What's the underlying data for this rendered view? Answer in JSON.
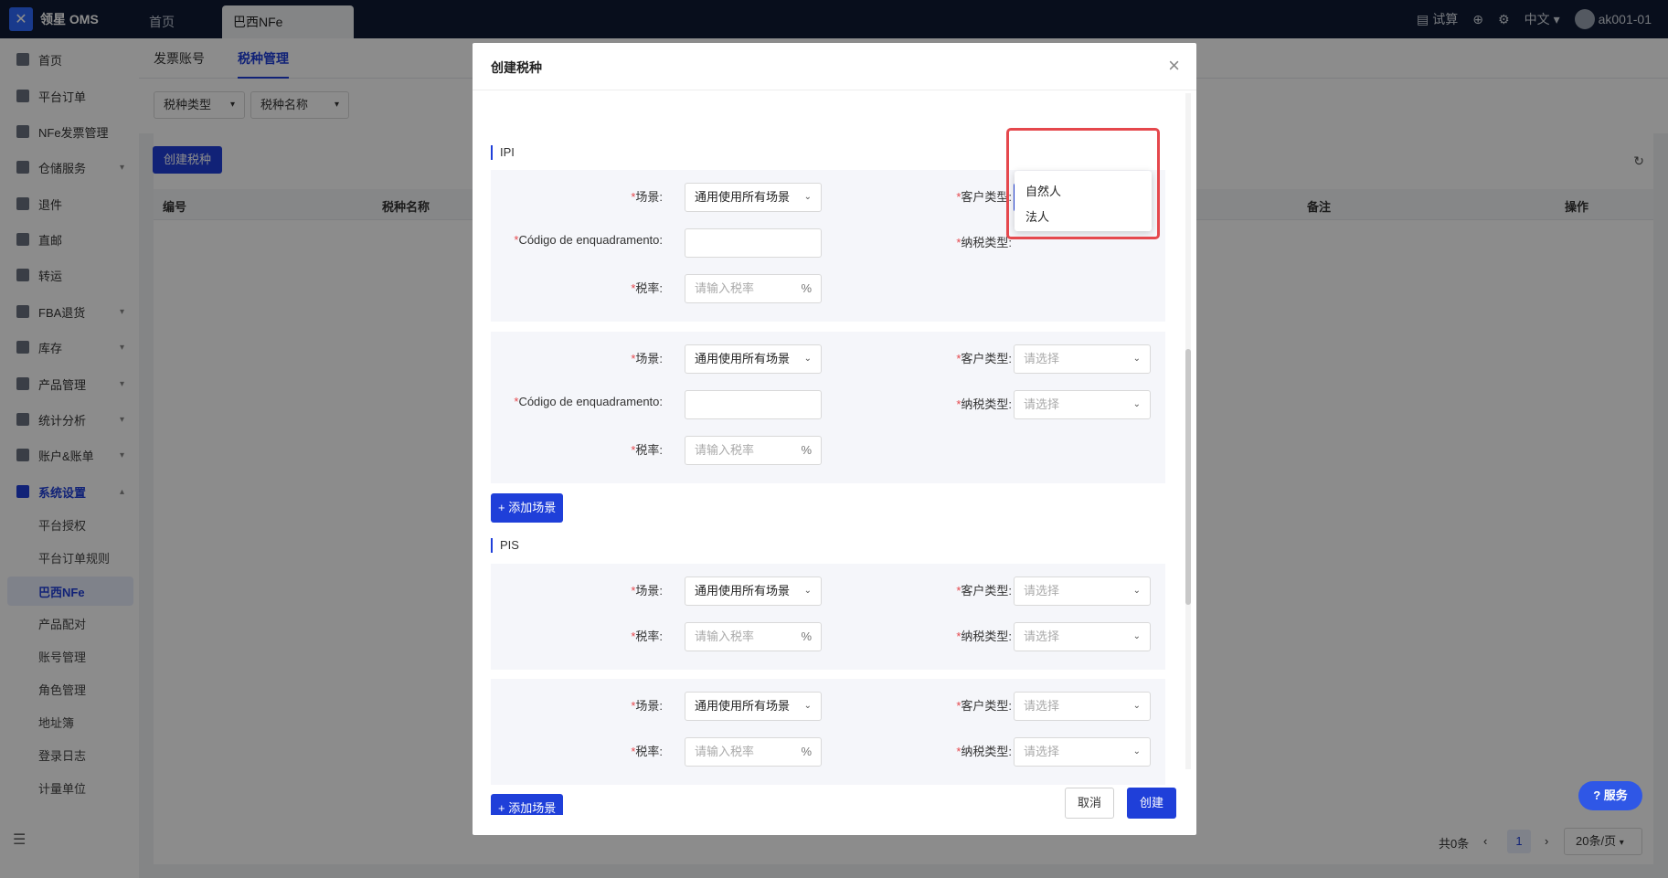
{
  "brand": {
    "name": "领星 OMS",
    "accent": "#1f3fd9"
  },
  "top_tabs": [
    "首页",
    "巴西NFe"
  ],
  "top_right": {
    "trial": "试算",
    "lang": "中文",
    "user": "ak001-01"
  },
  "sidebar": {
    "items": [
      "首页",
      "平台订单",
      "NFe发票管理",
      "仓储服务",
      "退件",
      "直邮",
      "转运",
      "FBA退货",
      "库存",
      "产品管理",
      "统计分析",
      "账户&账单",
      "系统设置"
    ],
    "sub_items": [
      "平台授权",
      "平台订单规则",
      "巴西NFe",
      "产品配对",
      "账号管理",
      "角色管理",
      "地址簿",
      "登录日志",
      "计量单位"
    ],
    "active_sub": "巴西NFe"
  },
  "page_tabs": [
    "发票账号",
    "税种管理"
  ],
  "filters": {
    "tax_type": "税种类型",
    "tax_name": "税种名称"
  },
  "create_button": "创建税种",
  "table": {
    "headers": [
      "编号",
      "税种名称",
      "备注",
      "操作"
    ]
  },
  "pager": {
    "total": "共0条",
    "page": "1",
    "size": "20条/页"
  },
  "modal": {
    "title": "创建税种",
    "labels": {
      "scene": "场景:",
      "customer_type": "客户类型:",
      "code": "Código de enquadramento:",
      "tax_payer_type": "纳税类型:",
      "rate": "税率:"
    },
    "scene_value": "通用使用所有场景",
    "select_placeholder": "请选择",
    "rate_placeholder": "请输入税率",
    "pct": "%",
    "add_scene": "添加场景",
    "sections": [
      "IPI",
      "PIS"
    ],
    "dropdown_options": [
      "自然人",
      "法人"
    ],
    "cancel": "取消",
    "submit": "创建"
  },
  "service_button": "服务"
}
